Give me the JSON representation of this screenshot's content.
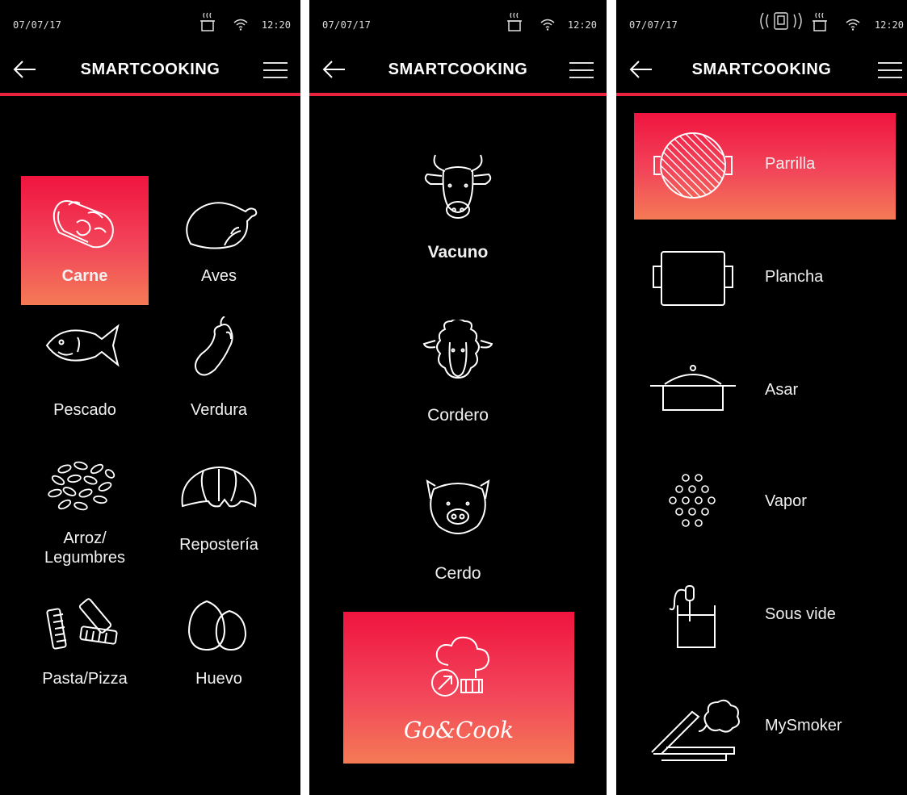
{
  "status": {
    "date": "07/07/17",
    "time": "12:20"
  },
  "app": {
    "title": "SMARTCOOKING"
  },
  "colors": {
    "accent": "#e8223f",
    "gradient_top": "#f0143f",
    "gradient_bottom": "#f47a55"
  },
  "categories": [
    {
      "label": "Carne",
      "selected": true,
      "icon": "meat-icon"
    },
    {
      "label": "Aves",
      "selected": false,
      "icon": "chicken-icon"
    },
    {
      "label": "Pescado",
      "selected": false,
      "icon": "fish-icon"
    },
    {
      "label": "Verdura",
      "selected": false,
      "icon": "eggplant-icon"
    },
    {
      "label": "Arroz/",
      "label2": "Legumbres",
      "selected": false,
      "icon": "rice-icon"
    },
    {
      "label": "Repostería",
      "selected": false,
      "icon": "croissant-icon"
    },
    {
      "label": "Pasta/Pizza",
      "selected": false,
      "icon": "pasta-icon"
    },
    {
      "label": "Huevo",
      "selected": false,
      "icon": "egg-icon"
    }
  ],
  "animals": [
    {
      "label": "Vacuno",
      "bold": true,
      "icon": "cow-icon"
    },
    {
      "label": "Cordero",
      "bold": false,
      "icon": "sheep-icon"
    },
    {
      "label": "Cerdo",
      "bold": false,
      "icon": "pig-icon"
    }
  ],
  "gocook": {
    "label": "Go&Cook",
    "icon": "chef-hat-icon"
  },
  "methods": [
    {
      "label": "Parrilla",
      "selected": true,
      "icon": "grill-icon"
    },
    {
      "label": "Plancha",
      "selected": false,
      "icon": "griddle-icon"
    },
    {
      "label": "Asar",
      "selected": false,
      "icon": "roasting-pot-icon"
    },
    {
      "label": "Vapor",
      "selected": false,
      "icon": "steam-icon"
    },
    {
      "label": "Sous vide",
      "selected": false,
      "icon": "sous-vide-icon"
    },
    {
      "label": "MySmoker",
      "selected": false,
      "icon": "smoker-icon"
    }
  ]
}
